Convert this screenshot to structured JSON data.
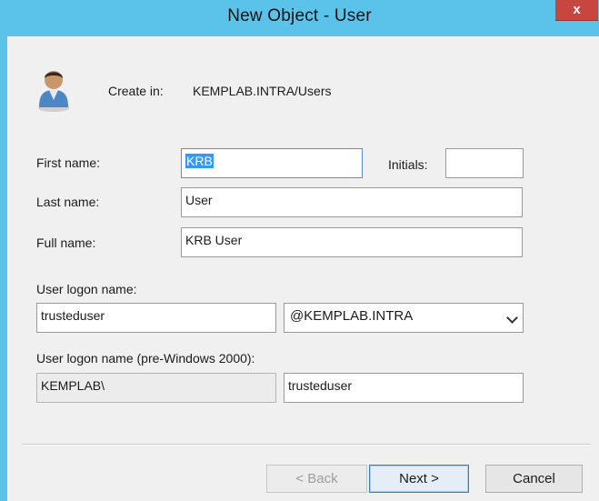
{
  "window": {
    "title": "New Object - User",
    "close_label": "x"
  },
  "header": {
    "create_in_label": "Create in:",
    "create_in_value": "KEMPLAB.INTRA/Users",
    "icon": "user-icon"
  },
  "form": {
    "first_name_label": "First name:",
    "first_name_value": "KRB",
    "initials_label": "Initials:",
    "initials_value": "",
    "last_name_label": "Last name:",
    "last_name_value": "User",
    "full_name_label": "Full name:",
    "full_name_value": "KRB User",
    "logon_label": "User logon name:",
    "logon_value": "trusteduser",
    "logon_domain": "@KEMPLAB.INTRA",
    "pre2000_label": "User logon name (pre-Windows 2000):",
    "pre2000_domain": "KEMPLAB\\",
    "pre2000_value": "trusteduser"
  },
  "buttons": {
    "back": "< Back",
    "next": "Next >",
    "cancel": "Cancel"
  },
  "colors": {
    "titlebar": "#5bc2ea",
    "close": "#c7463f",
    "selection": "#3399ff"
  }
}
